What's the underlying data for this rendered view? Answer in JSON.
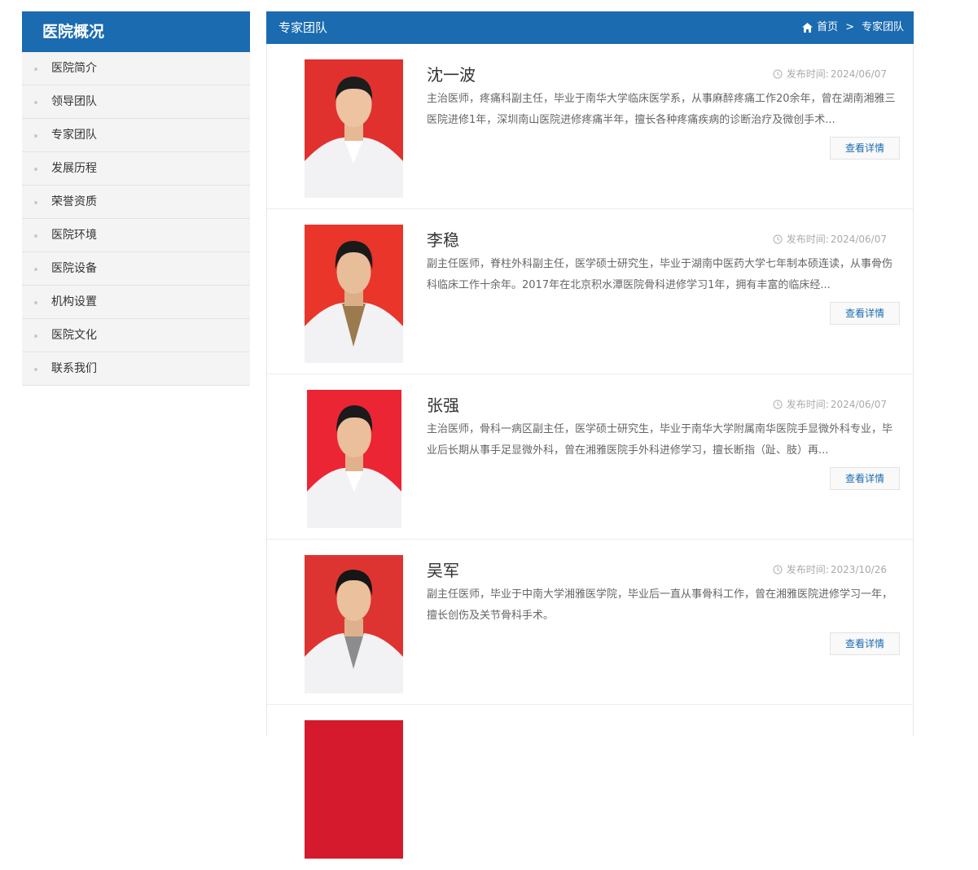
{
  "sidebar": {
    "title": "医院概况",
    "items": [
      {
        "label": "医院简介"
      },
      {
        "label": "领导团队"
      },
      {
        "label": "专家团队"
      },
      {
        "label": "发展历程"
      },
      {
        "label": "荣誉资质"
      },
      {
        "label": "医院环境"
      },
      {
        "label": "医院设备"
      },
      {
        "label": "机构设置"
      },
      {
        "label": "医院文化"
      },
      {
        "label": "联系我们"
      }
    ]
  },
  "header": {
    "title": "专家团队",
    "breadcrumb": {
      "home": "首页",
      "separator": ">",
      "current": "专家团队"
    }
  },
  "colors": {
    "accent": "#1a6bb0",
    "photo_background_red": "#e0312f"
  },
  "icons": {
    "home": "home-icon",
    "date": "clock-icon"
  },
  "experts": [
    {
      "name": "沈一波",
      "date_label": "发布时间:",
      "date": "2024/06/07",
      "description": "主治医师，疼痛科副主任，毕业于南华大学临床医学系，从事麻醉疼痛工作20余年，曾在湖南湘雅三医院进修1年，深圳南山医院进修疼痛半年，擅长各种疼痛疾病的诊断治疗及微创手术...",
      "button": "查看详情"
    },
    {
      "name": "李稳",
      "date_label": "发布时间:",
      "date": "2024/06/07",
      "description": "副主任医师，脊柱外科副主任，医学硕士研究生，毕业于湖南中医药大学七年制本硕连读，从事骨伤科临床工作十余年。2017年在北京积水潭医院骨科进修学习1年，拥有丰富的临床经...",
      "button": "查看详情"
    },
    {
      "name": "张强",
      "date_label": "发布时间:",
      "date": "2024/06/07",
      "description": "主治医师，骨科一病区副主任，医学硕士研究生，毕业于南华大学附属南华医院手显微外科专业，毕业后长期从事手足显微外科，曾在湘雅医院手外科进修学习，擅长断指（趾、肢）再...",
      "button": "查看详情"
    },
    {
      "name": "吴军",
      "date_label": "发布时间:",
      "date": "2023/10/26",
      "description": "副主任医师，毕业于中南大学湘雅医学院，毕业后一直从事骨科工作，曾在湘雅医院进修学习一年，擅长创伤及关节骨科手术。",
      "button": "查看详情"
    },
    {
      "name": "",
      "date_label": "",
      "date": "",
      "description": "",
      "button": ""
    }
  ]
}
